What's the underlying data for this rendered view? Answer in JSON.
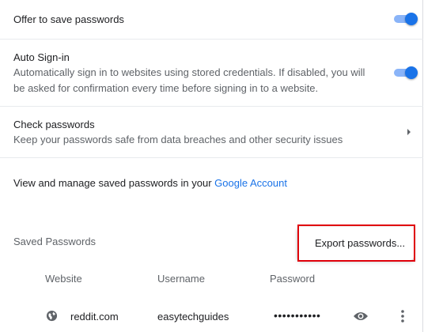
{
  "settings": {
    "offer_to_save": {
      "title": "Offer to save passwords",
      "enabled": true
    },
    "auto_signin": {
      "title": "Auto Sign-in",
      "description": "Automatically sign in to websites using stored credentials. If disabled, you will be asked for confirmation every time before signing in to a website.",
      "enabled": true
    },
    "check_passwords": {
      "title": "Check passwords",
      "description": "Keep your passwords safe from data breaches and other security issues"
    },
    "manage": {
      "text": "View and manage saved passwords in your ",
      "link": "Google Account"
    }
  },
  "saved_passwords": {
    "heading": "Saved Passwords",
    "menu": {
      "export_label": "Export passwords..."
    },
    "columns": [
      "Website",
      "Username",
      "Password"
    ],
    "rows": [
      {
        "site": "reddit.com",
        "username": "easytechguides",
        "password": "•••••••••••"
      }
    ]
  },
  "colors": {
    "accent": "#1a73e8",
    "highlight": "#e0000a"
  }
}
